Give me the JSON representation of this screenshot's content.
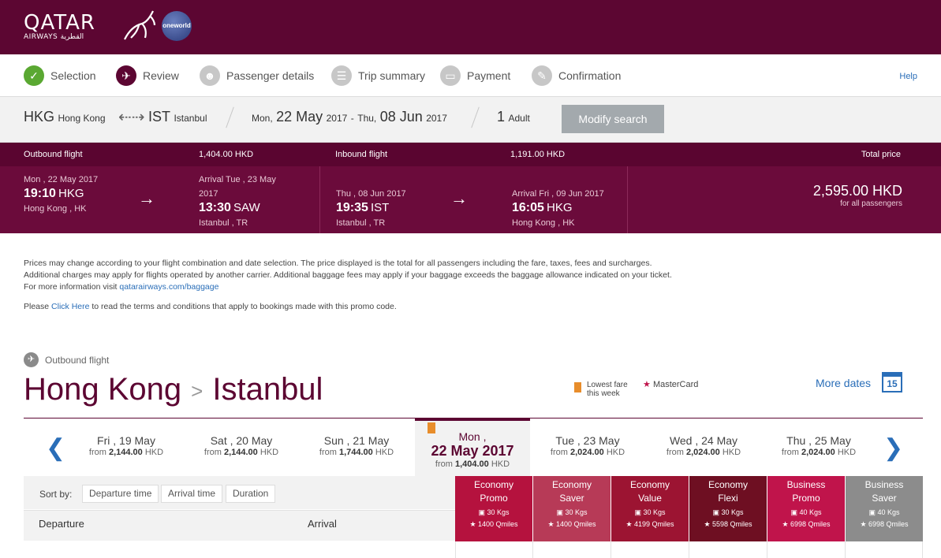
{
  "brand": {
    "name": "QATAR",
    "sub": "AIRWAYS القطرية",
    "alliance": "oneworld"
  },
  "steps": [
    {
      "label": "Selection",
      "icon": "check-icon",
      "state": "done"
    },
    {
      "label": "Review",
      "icon": "plane-icon",
      "state": "current"
    },
    {
      "label": "Passenger details",
      "icon": "person-icon",
      "state": "todo"
    },
    {
      "label": "Trip summary",
      "icon": "document-icon",
      "state": "todo"
    },
    {
      "label": "Payment",
      "icon": "payment-icon",
      "state": "todo"
    },
    {
      "label": "Confirmation",
      "icon": "confirmation-icon",
      "state": "todo"
    }
  ],
  "help": "Help",
  "search": {
    "from_code": "HKG",
    "from_city": "Hong Kong",
    "to_code": "IST",
    "to_city": "Istanbul",
    "dep_dow": "Mon,",
    "dep_day": "22 May",
    "dep_year": "2017",
    "sep": "-",
    "ret_dow": "Thu,",
    "ret_day": "08 Jun",
    "ret_year": "2017",
    "pax_count": "1",
    "pax_label": "Adult",
    "modify": "Modify search"
  },
  "fare": {
    "outbound_label": "Outbound flight",
    "outbound_price": "1,404.00 HKD",
    "inbound_label": "Inbound flight",
    "inbound_price": "1,191.00 HKD",
    "total_label": "Total price",
    "out": {
      "dep_date": "Mon , 22 May 2017",
      "dep_time": "19:10",
      "dep_code": "HKG",
      "dep_place": "Hong Kong , HK",
      "arr_date": "Arrival Tue , 23 May",
      "arr_date2": "2017",
      "arr_time": "13:30",
      "arr_code": "SAW",
      "arr_place": "Istanbul , TR"
    },
    "in": {
      "dep_date": "Thu , 08 Jun 2017",
      "dep_time": "19:35",
      "dep_code": "IST",
      "dep_place": "Istanbul , TR",
      "arr_date": "Arrival Fri , 09 Jun 2017",
      "arr_time": "16:05",
      "arr_code": "HKG",
      "arr_place": "Hong Kong , HK"
    },
    "total": "2,595.00 HKD",
    "total_note": "for all passengers"
  },
  "info": {
    "p1a": "Prices may change according to your flight combination and date selection. The price displayed is the total for all passengers including the fare, taxes, fees and surcharges. Additional charges may apply for flights operated by another carrier. Additional baggage fees may apply if your baggage exceeds the baggage allowance indicated on your ticket. For more information visit ",
    "p1link": "qatarairways.com/baggage",
    "p2a": "Please ",
    "p2link": "Click Here",
    "p2b": " to read the terms and conditions that apply to bookings made with this promo code."
  },
  "outbound": {
    "label": "Outbound flight",
    "from": "Hong Kong",
    "to": "Istanbul",
    "legend_lowest_1": "Lowest fare",
    "legend_lowest_2": "this week",
    "legend_mc": "MasterCard",
    "more_dates": "More dates",
    "calendar_day": "15"
  },
  "dates": [
    {
      "day": "Fri , 19 May",
      "from": "from",
      "price": "2,144.00",
      "cur": "HKD"
    },
    {
      "day": "Sat , 20 May",
      "from": "from",
      "price": "2,144.00",
      "cur": "HKD"
    },
    {
      "day": "Sun , 21 May",
      "from": "from",
      "price": "1,744.00",
      "cur": "HKD"
    },
    {
      "day": "Mon ,",
      "day2": "22 May 2017",
      "from": "from",
      "price": "1,404.00",
      "cur": "HKD"
    },
    {
      "day": "Tue , 23 May",
      "from": "from",
      "price": "2,024.00",
      "cur": "HKD"
    },
    {
      "day": "Wed , 24 May",
      "from": "from",
      "price": "2,024.00",
      "cur": "HKD"
    },
    {
      "day": "Thu , 25 May",
      "from": "from",
      "price": "2,024.00",
      "cur": "HKD"
    }
  ],
  "sort": {
    "label": "Sort by:",
    "options": [
      "Departure time",
      "Arrival time",
      "Duration"
    ]
  },
  "columns": {
    "departure": "Departure",
    "arrival": "Arrival"
  },
  "classes": [
    {
      "l1": "Economy",
      "l2": "Promo",
      "kg": "30 Kgs",
      "miles": "1400 Qmiles",
      "color": "#b5123e"
    },
    {
      "l1": "Economy",
      "l2": "Saver",
      "kg": "30 Kgs",
      "miles": "1400 Qmiles",
      "color": "#b73a57"
    },
    {
      "l1": "Economy",
      "l2": "Value",
      "kg": "30 Kgs",
      "miles": "4199 Qmiles",
      "color": "#9c1432"
    },
    {
      "l1": "Economy",
      "l2": "Flexi",
      "kg": "30 Kgs",
      "miles": "5598 Qmiles",
      "color": "#6e0f22"
    },
    {
      "l1": "Business",
      "l2": "Promo",
      "kg": "40 Kgs",
      "miles": "6998 Qmiles",
      "color": "#c0144b"
    },
    {
      "l1": "Business",
      "l2": "Saver",
      "kg": "40 Kgs",
      "miles": "6998 Qmiles",
      "color": "#8c8c8c"
    }
  ],
  "colors": {
    "brand": "#5c0632",
    "link": "#2a6eb8",
    "highlight": "#e88d2b"
  }
}
